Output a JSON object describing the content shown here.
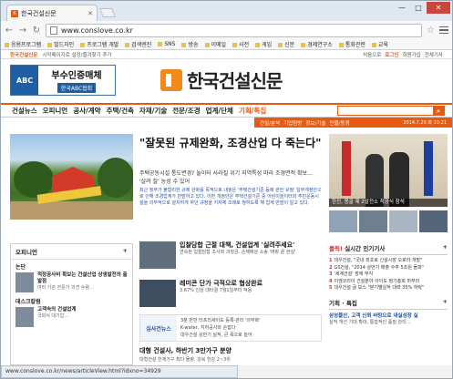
{
  "browser": {
    "tab_title": "한국건설신문",
    "url": "www.conslove.co.kr",
    "bookmarks": [
      "응용프로그램",
      "빌드자인",
      "프로그램 개발",
      "검색엔진",
      "SNS",
      "방송",
      "이메일",
      "사전",
      "게임",
      "신문",
      "경제연구소",
      "통화관련",
      "교육"
    ],
    "status_url": "www.conslove.co.kr/news/articleView.html?idxno=34929"
  },
  "topbar": {
    "home_label": "한국건설신문",
    "notice": "시작페이지로 설정/즐겨찾기 추가",
    "links": [
      "처음으로",
      "로그인",
      "회원가입",
      "전체기사"
    ]
  },
  "ad": {
    "logo_text": "ABC",
    "title": "부수인증매체",
    "subtitle": "한국ABC협회"
  },
  "logo": {
    "name": "한국건설신문"
  },
  "menu": {
    "items": [
      "건설뉴스",
      "오피니언",
      "공사/계약",
      "주택/건축",
      "자재/기술",
      "전문/조경",
      "업계/단체"
    ],
    "special": "기획/특집"
  },
  "subbar": {
    "items": [
      "건설/분석",
      "기업탐방",
      "정보/기술",
      "인물/동정"
    ],
    "date": "2014.7.29 화 10:21"
  },
  "headline": {
    "title": "\"잘못된 규제완화, 조경산업 다 죽는다\"",
    "subtitle": "주택공동시설 통도변경? 놀이터 사라질 위기 지역특성 따라 조경면적 확보… '살려 잘' 농성 수 있어",
    "body": "최근 정부가 불합리한 규제 완화를 목적으로 내놓은 '주택건설기준 등에 관한 규정' 일부개정안으로 인해 조경업계가 반발하고 있다. 이번 개정안은 주택건설기준 중 어린이놀이터와 주민운동시설을 의무적으로 설치하게 하던 규정을 지자체 조례로 정하도록 해 업계 반발이 일고 있다."
  },
  "right_photo": {
    "caption": "한전, 몽골 제 2발전소 착공식 참석"
  },
  "left_col": {
    "title": "오피니언",
    "more": "+",
    "sections": [
      {
        "heading": "논단",
        "title": "적정공사비 확보는 건설산업 상생발전의 출발점",
        "desc": "여러 기관 전문가 의견 수렴…"
      },
      {
        "heading": "데스크칼럼",
        "title": "고객속의 건설업계",
        "desc": "국회서 대기업…"
      }
    ]
  },
  "mid_list": [
    {
      "title": "입찰담합 근절 대책, 건설업계 '실려주세요'",
      "desc": "연속된 입찰담합 조사와 과징금, 손해배상 소송 '벼랑 끝 현실'"
    },
    {
      "title": "레미콘 단가 극적으로 협상완료",
      "desc": "3.67% 인상 대타결 7월1일부터 적용"
    }
  ],
  "boxed": {
    "tag": "심사건뉴스",
    "lines": [
      "3분 만만 터프리세이도 등록·관리 '의무화'",
      "K-water, 지하공사와 손잡다",
      "대우건설 상반기 실적, 큰 폭으로 늘어"
    ]
  },
  "bottom": {
    "title": "대형 건설사, 하반기 3만가구 분양",
    "desc": "대형건설 한계가구 최다 물량, 강북 한강 2~3위"
  },
  "right_col": {
    "title": "실시간 인기기사",
    "hot_label": "클릭!",
    "more": "+",
    "items": [
      "대우건설, \"국내 최초로 신설시장 오로라 개발\"",
      "GS건설, \"2014 상반기 매출 수주 5조원 돌파\"",
      "'세계건설' 장애 부각",
      "이엠코리아 건설분야 아이도 정기총회 마무리",
      "대우건설 글 보스 \"분기별실적 대략 35% 하락\""
    ],
    "section2": "기획 · 특집",
    "section2_more": "+",
    "feature_title": "삼성물산, 고객 신뢰 바탕으로 내실성장 실",
    "feature_desc": "실적 개선 기대 확대, 통합적인 품질 관리…"
  }
}
